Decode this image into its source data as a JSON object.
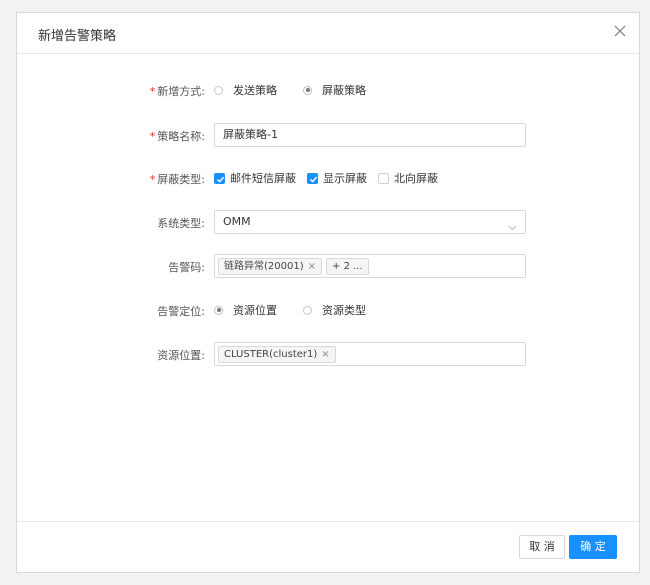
{
  "dialog": {
    "title": "新增告警策略"
  },
  "form": {
    "mode": {
      "label": "新增方式:",
      "required": "*",
      "options": [
        "发送策略",
        "屏蔽策略"
      ],
      "selected": "屏蔽策略"
    },
    "name": {
      "label": "策略名称:",
      "required": "*",
      "value": "屏蔽策略-1"
    },
    "mask_type": {
      "label": "屏蔽类型:",
      "required": "*",
      "options": [
        {
          "label": "邮件短信屏蔽",
          "checked": true
        },
        {
          "label": "显示屏蔽",
          "checked": true
        },
        {
          "label": "北向屏蔽",
          "checked": false
        }
      ]
    },
    "system_type": {
      "label": "系统类型:",
      "value": "OMM"
    },
    "alarm_code": {
      "label": "告警码:",
      "tags": [
        "链路异常(20001)"
      ],
      "more": "+ 2 ..."
    },
    "location_mode": {
      "label": "告警定位:",
      "options": [
        "资源位置",
        "资源类型"
      ],
      "selected": "资源位置"
    },
    "resource_location": {
      "label": "资源位置:",
      "tags": [
        "CLUSTER(cluster1)"
      ]
    }
  },
  "footer": {
    "cancel_label": "取 消",
    "ok_label": "确 定"
  },
  "icons": {
    "close": "close-icon",
    "dropdown": "chevron-down-icon",
    "tag_remove": "×"
  },
  "colors": {
    "primary": "#1890ff",
    "required": "#f5222d"
  }
}
